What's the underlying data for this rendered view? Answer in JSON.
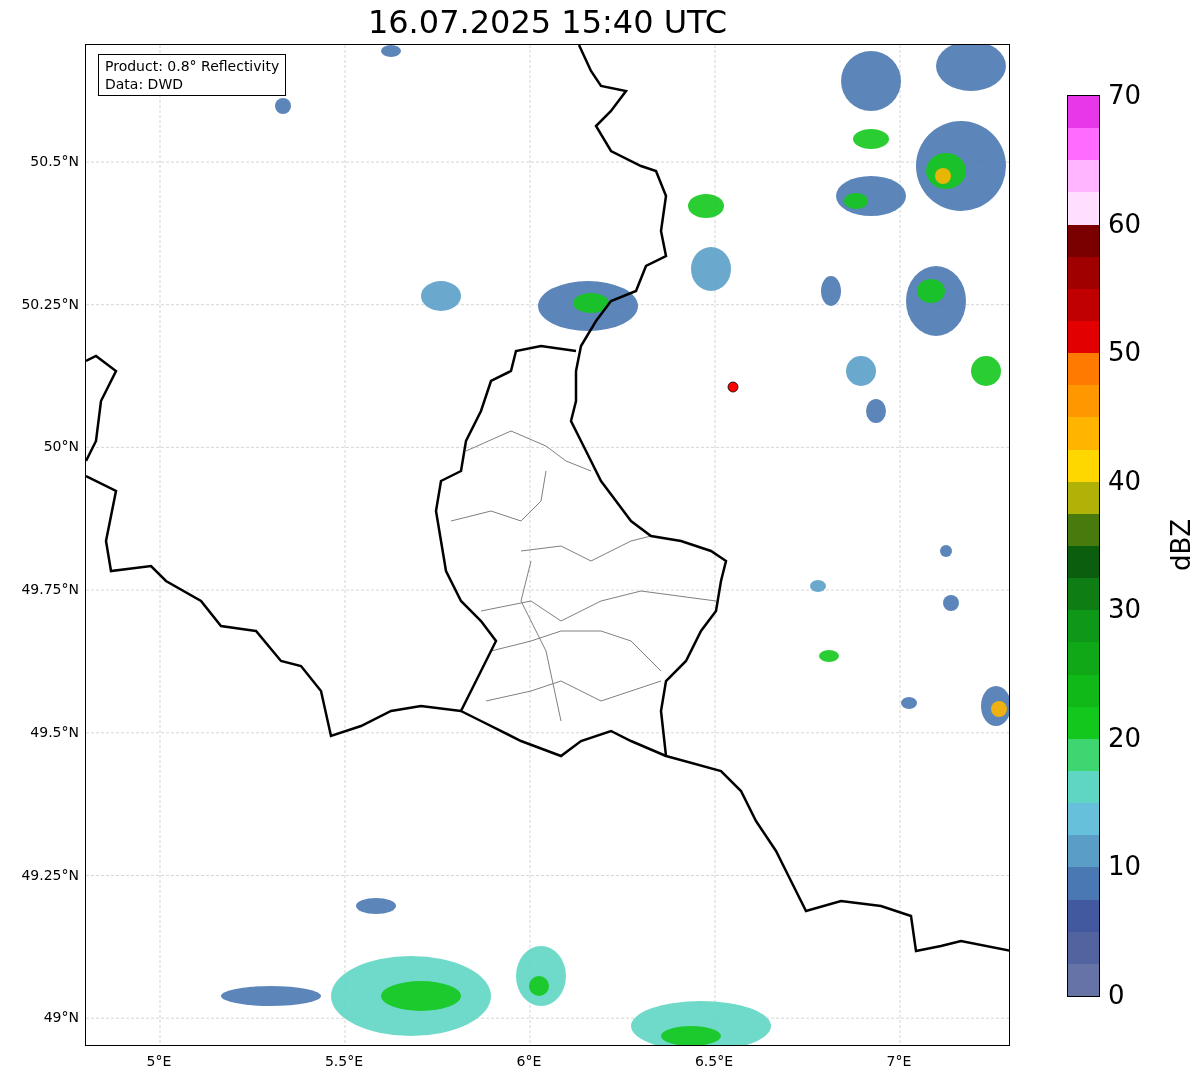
{
  "title": "16.07.2025 15:40 UTC",
  "legend": {
    "lines": [
      "Product: 0.8° Reflectivity",
      "Data: DWD"
    ]
  },
  "y_ticks": [
    "50.5°N",
    "50.25°N",
    "50°N",
    "49.75°N",
    "49.5°N",
    "49.25°N",
    "49°N"
  ],
  "x_ticks": [
    "5°E",
    "5.5°E",
    "6°E",
    "6.5°E",
    "7°E"
  ],
  "colorbar": {
    "label": "dBZ",
    "ticks": [
      "70",
      "60",
      "50",
      "40",
      "30",
      "20",
      "10",
      "0"
    ],
    "segments": [
      {
        "color": "#6673a6"
      },
      {
        "color": "#52649f"
      },
      {
        "color": "#4259a0"
      },
      {
        "color": "#4a78b2"
      },
      {
        "color": "#5a9ec8"
      },
      {
        "color": "#66c0dc"
      },
      {
        "color": "#5fd6c4"
      },
      {
        "color": "#3dd670"
      },
      {
        "color": "#13c81c"
      },
      {
        "color": "#10b918"
      },
      {
        "color": "#10a816"
      },
      {
        "color": "#0f9817"
      },
      {
        "color": "#0d7d14"
      },
      {
        "color": "#0a5e0e"
      },
      {
        "color": "#487a0e"
      },
      {
        "color": "#b0b208"
      },
      {
        "color": "#ffd700"
      },
      {
        "color": "#ffb500"
      },
      {
        "color": "#ff9800"
      },
      {
        "color": "#ff7a00"
      },
      {
        "color": "#e30000"
      },
      {
        "color": "#c00000"
      },
      {
        "color": "#a00000"
      },
      {
        "color": "#7a0000"
      },
      {
        "color": "#ffdfff"
      },
      {
        "color": "#ffb5ff"
      },
      {
        "color": "#ff6bff"
      },
      {
        "color": "#e837e8"
      }
    ]
  }
}
